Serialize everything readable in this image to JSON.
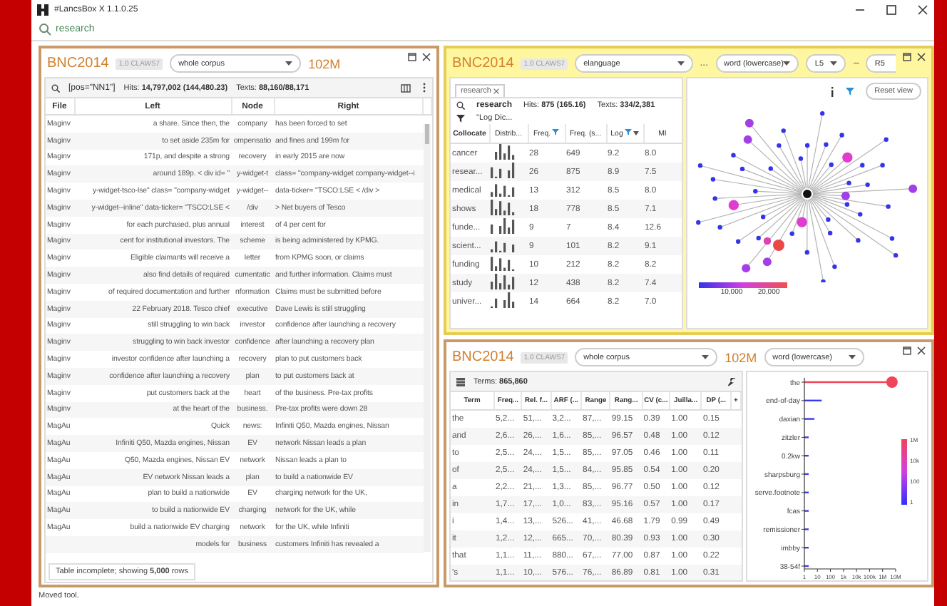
{
  "window": {
    "title": "#LancsBox X 1.1.0.25"
  },
  "search": {
    "value": "research"
  },
  "kwic_panel": {
    "corpus": "BNC2014",
    "tagset": "1.0 CLAWS7",
    "subcorpus": "whole corpus",
    "size": "102M",
    "query": "[pos=\"NN1\"]",
    "hits": "Hits: **14,797,002 (144,480.23)**",
    "texts": "Texts: **88,160/88,171**",
    "columns": [
      "File",
      "Left",
      "Node",
      "Right"
    ],
    "rows": [
      [
        "Maginv",
        "a share. Since then, the",
        "company",
        "has been forced to set"
      ],
      [
        "Maginv",
        "to set aside 235m for",
        "ompensatio",
        "and fines and 199m for"
      ],
      [
        "Maginv",
        "171p, and despite a strong",
        "recovery",
        "in early 2015 are now"
      ],
      [
        "Maginv",
        "around 189p. < div id= \"",
        "y-widget-t",
        "class= \"company-widget company-widget--i"
      ],
      [
        "Maginv",
        "y-widget-tsco-lse\" class= \"company-widget",
        "y-widget--",
        "data-ticker= \"TSCO:LSE < /div >"
      ],
      [
        "Maginv",
        "y-widget--inline\" data-ticker= \"TSCO:LSE <",
        "/div",
        "> Net buyers of Tesco"
      ],
      [
        "Maginv",
        "for each purchased, plus annual",
        "interest",
        "of 4 per cent for"
      ],
      [
        "Maginv",
        "cent for institutional investors. The",
        "scheme",
        "is being administered by KPMG."
      ],
      [
        "Maginv",
        "Eligible claimants will receive a",
        "letter",
        "from KPMG soon, or claims"
      ],
      [
        "Maginv",
        "also find details of required",
        "cumentatic",
        "and further information. Claims must"
      ],
      [
        "Maginv",
        "of required documentation and further",
        "nformation",
        "Claims must be submitted before"
      ],
      [
        "Maginv",
        "22 February 2018. Tesco chief",
        "executive",
        "Dave Lewis is still struggling"
      ],
      [
        "Maginv",
        "still struggling to win back",
        "investor",
        "confidence after launching a recovery"
      ],
      [
        "Maginv",
        "struggling to win back investor",
        "confidence",
        "after launching a recovery plan"
      ],
      [
        "Maginv",
        "investor confidence after launching a",
        "recovery",
        "plan to put customers back"
      ],
      [
        "Maginv",
        "confidence after launching a recovery",
        "plan",
        "to put customers back at"
      ],
      [
        "Maginv",
        "put customers back at the",
        "heart",
        "of the business. Pre-tax profits"
      ],
      [
        "Maginv",
        "at the heart of the",
        "business.",
        "Pre-tax profits were down 28"
      ],
      [
        "MagAu",
        "Quick",
        "news:",
        "Infiniti Q50, Mazda engines, Nissan"
      ],
      [
        "MagAu",
        "Infiniti Q50, Mazda engines, Nissan",
        "EV",
        "network Nissan leads a plan"
      ],
      [
        "MagAu",
        "Q50, Mazda engines, Nissan EV",
        "network",
        "Nissan leads a plan to"
      ],
      [
        "MagAu",
        "EV network Nissan leads a",
        "plan",
        "to build a nationwide EV"
      ],
      [
        "MagAu",
        "plan to build a nationwide",
        "EV",
        "charging network for the UK,"
      ],
      [
        "MagAu",
        "to build a nationwide EV",
        "charging",
        "network for the UK, while"
      ],
      [
        "MagAu",
        "build a nationwide EV charging",
        "network",
        "for the UK, while Infiniti"
      ]
    ],
    "last_row": {
      "left": "models for",
      "node": "business",
      "right": "customers Infiniti has revealed a"
    },
    "notice": "Table incomplete; showing **5,000** rows"
  },
  "collocation_panel": {
    "corpus": "BNC2014",
    "tagset": "1.0 CLAWS7",
    "node_field": "elanguage",
    "ellipsis": "...",
    "attribute": "word (lowercase)",
    "left_span": "L5",
    "dash": "–",
    "right_span": "R5",
    "tab": {
      "label": "research"
    },
    "query": "research",
    "hits": "Hits: **875 (165.16)**",
    "texts": "Texts: **334/2,381**",
    "filter": "\"Log Dic...",
    "columns": [
      {
        "label": "Collocate",
        "filter": false,
        "sorted": false
      },
      {
        "label": "Distrib...",
        "filter": false,
        "sorted": false
      },
      {
        "label": "Freq.",
        "filter": true,
        "sorted": false
      },
      {
        "label": "Freq. (s...",
        "filter": false,
        "sorted": false
      },
      {
        "label": "Log",
        "filter": true,
        "sorted": true
      },
      {
        "label": "MI",
        "filter": false,
        "sorted": false
      }
    ],
    "rows": [
      {
        "collocate": "cancer",
        "freq": "28",
        "freq_s": "649",
        "log": "9.2",
        "mi": "8.0"
      },
      {
        "collocate": "resear...",
        "freq": "26",
        "freq_s": "875",
        "log": "8.9",
        "mi": "7.5"
      },
      {
        "collocate": "medical",
        "freq": "13",
        "freq_s": "312",
        "log": "8.5",
        "mi": "8.0"
      },
      {
        "collocate": "shows",
        "freq": "18",
        "freq_s": "778",
        "log": "8.5",
        "mi": "7.1"
      },
      {
        "collocate": "funde...",
        "freq": "9",
        "freq_s": "7",
        "log": "8.4",
        "mi": "12.6"
      },
      {
        "collocate": "scient...",
        "freq": "9",
        "freq_s": "101",
        "log": "8.2",
        "mi": "9.1"
      },
      {
        "collocate": "funding",
        "freq": "10",
        "freq_s": "212",
        "log": "8.2",
        "mi": "8.2"
      },
      {
        "collocate": "study",
        "freq": "12",
        "freq_s": "438",
        "log": "8.2",
        "mi": "7.4"
      },
      {
        "collocate": "univer...",
        "freq": "14",
        "freq_s": "664",
        "log": "8.2",
        "mi": "7.0"
      }
    ],
    "graph": {
      "reset_button": "Reset view",
      "legend_ticks": [
        "10,000",
        "20,000"
      ]
    }
  },
  "wordlist_panel": {
    "corpus": "BNC2014",
    "tagset": "1.0 CLAWS7",
    "subcorpus": "whole corpus",
    "size": "102M",
    "attribute": "word (lowercase)",
    "terms": "Terms: **865,860**",
    "columns": [
      "Term",
      "Freq...",
      "Rel. f...",
      "ARF (...",
      "Range",
      "Rang...",
      "CV (c...",
      "Juilla...",
      "DP (...",
      "+"
    ],
    "rows": [
      [
        "the",
        "5,2...",
        "51,...",
        "3,2...",
        "87,...",
        "99.15",
        "0.39",
        "1.00",
        "0.15"
      ],
      [
        "and",
        "2,6...",
        "26,...",
        "1,6...",
        "85,...",
        "96.57",
        "0.48",
        "1.00",
        "0.12"
      ],
      [
        "to",
        "2,5...",
        "24,...",
        "1,5...",
        "85,...",
        "97.05",
        "0.46",
        "1.00",
        "0.11"
      ],
      [
        "of",
        "2,5...",
        "24,...",
        "1,5...",
        "84,...",
        "95.85",
        "0.54",
        "1.00",
        "0.20"
      ],
      [
        "a",
        "2,2...",
        "21,...",
        "1,3...",
        "85,...",
        "96.77",
        "0.50",
        "1.00",
        "0.12"
      ],
      [
        "in",
        "1,7...",
        "17,...",
        "1,0...",
        "83,...",
        "95.16",
        "0.57",
        "1.00",
        "0.17"
      ],
      [
        "i",
        "1,4...",
        "13,...",
        "526...",
        "41,...",
        "46.68",
        "1.79",
        "0.99",
        "0.49"
      ],
      [
        "it",
        "1,2...",
        "12,...",
        "665...",
        "70,...",
        "80.39",
        "0.93",
        "1.00",
        "0.30"
      ],
      [
        "that",
        "1,1...",
        "11,...",
        "880...",
        "67,...",
        "77.00",
        "0.87",
        "1.00",
        "0.22"
      ],
      [
        "'s",
        "1,1...",
        "10,...",
        "576...",
        "76,...",
        "86.89",
        "0.81",
        "1.00",
        "0.31"
      ]
    ],
    "lollipop_chart": {
      "terms": [
        "the",
        "end-of-day",
        "daxian",
        "zitzler",
        "0.2kw",
        "sharpsburg",
        "serve.footnote",
        "fcas",
        "remissioner",
        "imbby",
        "38-54f"
      ],
      "x_axis_labels": [
        "1",
        "10",
        "100",
        "1k",
        "10k",
        "100k",
        "1M",
        "10M"
      ]
    },
    "legend_ticks": [
      "1M",
      "10k",
      "100",
      "1"
    ]
  },
  "status_bar": "Moved tool."
}
